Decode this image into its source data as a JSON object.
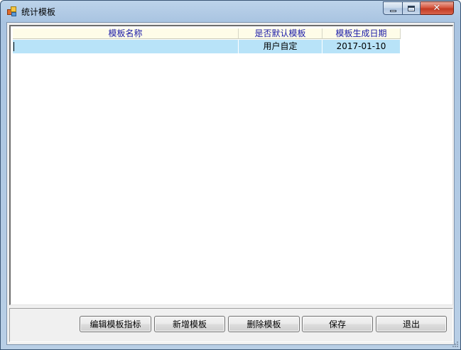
{
  "window": {
    "title": "统计模板",
    "controls": {
      "minimize": "minimize-icon",
      "maximize": "maximize-icon",
      "close": "close-icon"
    }
  },
  "grid": {
    "columns": [
      "模板名称",
      "是否默认模板",
      "模板生成日期"
    ],
    "rows": [
      [
        "",
        "用户自定",
        "2017-01-10"
      ]
    ],
    "selected_row_color": "#b8e3f8",
    "header_text_color": "#1a1aa8"
  },
  "buttons": {
    "edit_indicators": "编辑模板指标",
    "add_template": "新增模板",
    "delete_template": "删除模板",
    "save": "保存",
    "exit": "退出"
  }
}
